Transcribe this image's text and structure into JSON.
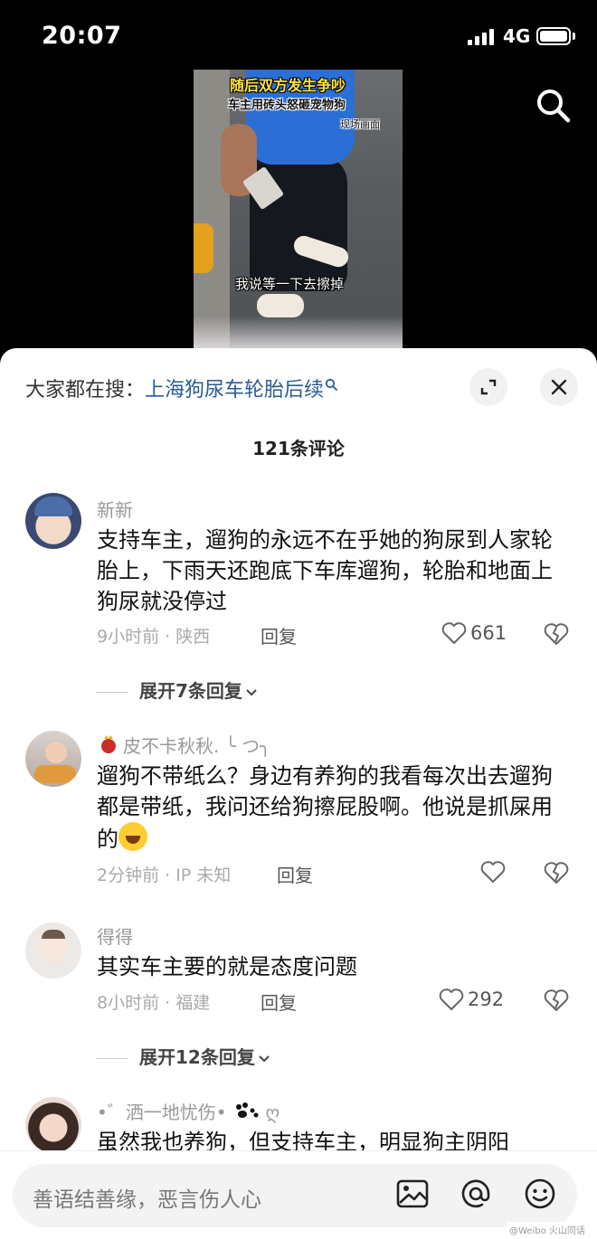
{
  "status_bar": {
    "time": "20:07",
    "network": "4G"
  },
  "video": {
    "caption_top": "随后双方发生争吵",
    "caption_mid": "车主用砖头怒砸宠物狗",
    "caption_tag": "现场画面",
    "subtitle": "我说等一下去擦掉"
  },
  "icons": {
    "top_search": "search-icon",
    "expand": "expand-icon",
    "close": "close-icon"
  },
  "sheet": {
    "trending_label": "大家都在搜：",
    "trending_query": "上海狗尿车轮胎后续",
    "comment_count": "121条评论"
  },
  "comments": [
    {
      "username": "新新",
      "text": "支持车主，遛狗的永远不在乎她的狗尿到人家轮胎上，下雨天还跑底下车库遛狗，轮胎和地面上狗尿就没停过",
      "meta": "9小时前 · 陕西",
      "reply": "回复",
      "likes": "661",
      "expand": "展开7条回复"
    },
    {
      "username": "皮不卡秋秋. ╰ つ╮",
      "text": "遛狗不带纸么？身边有养狗的我看每次出去遛狗都是带纸，我问还给狗擦屁股啊。他说是抓屎用的",
      "meta": "2分钟前 · IP 未知",
      "reply": "回复",
      "likes": ""
    },
    {
      "username": "得得",
      "text": "其实车主要的就是态度问题",
      "meta": "8小时前 · 福建",
      "reply": "回复",
      "likes": "292",
      "expand": "展开12条回复"
    },
    {
      "username": "•゛洒一地忧伤•",
      "username_suffix": "ღ",
      "text": "虽然我也养狗，但支持车主，明显狗主阴阳"
    }
  ],
  "input": {
    "placeholder": "善语结善缘，恶言伤人心"
  },
  "watermark": "@Weibo 火山同话",
  "colors": {
    "link": "#2b5b93",
    "sheet_bg": "#ffffff",
    "muted": "#999999"
  }
}
